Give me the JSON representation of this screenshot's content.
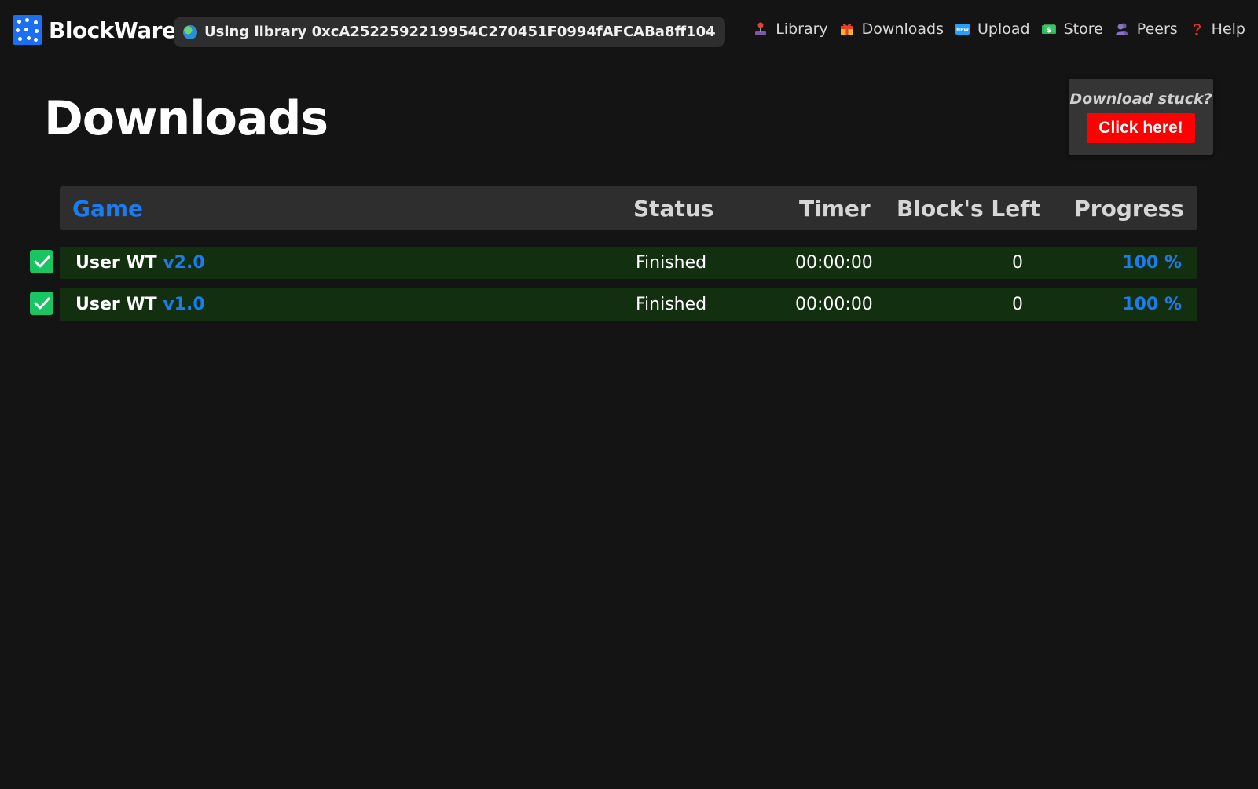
{
  "app": {
    "name": "BlockWare",
    "library_text": "Using library 0xcA2522592219954C270451F0994fAFCABa8ff104"
  },
  "nav": {
    "items": [
      {
        "label": "Library",
        "icon": "joystick-icon"
      },
      {
        "label": "Downloads",
        "icon": "gift-icon"
      },
      {
        "label": "Upload",
        "icon": "new-icon"
      },
      {
        "label": "Store",
        "icon": "money-icon"
      },
      {
        "label": "Peers",
        "icon": "people-icon"
      },
      {
        "label": "Help",
        "icon": "question-icon"
      }
    ]
  },
  "page": {
    "title": "Downloads"
  },
  "stuck": {
    "text": "Download stuck?",
    "button_label": "Click here!"
  },
  "table": {
    "headers": {
      "game": "Game",
      "status": "Status",
      "timer": "Timer",
      "blocks": "Block's Left",
      "progress": "Progress"
    },
    "rows": [
      {
        "game": "User WT",
        "version": "v2.0",
        "status": "Finished",
        "timer": "00:00:00",
        "blocks": "0",
        "progress": "100 %",
        "checked": true
      },
      {
        "game": "User WT",
        "version": "v1.0",
        "status": "Finished",
        "timer": "00:00:00",
        "blocks": "0",
        "progress": "100 %",
        "checked": true
      }
    ]
  },
  "colors": {
    "background": "#141414",
    "accent_blue": "#1b7cf0",
    "row_green": "#12300f",
    "checkbox_green": "#1bc463",
    "button_red": "#ff0000"
  }
}
